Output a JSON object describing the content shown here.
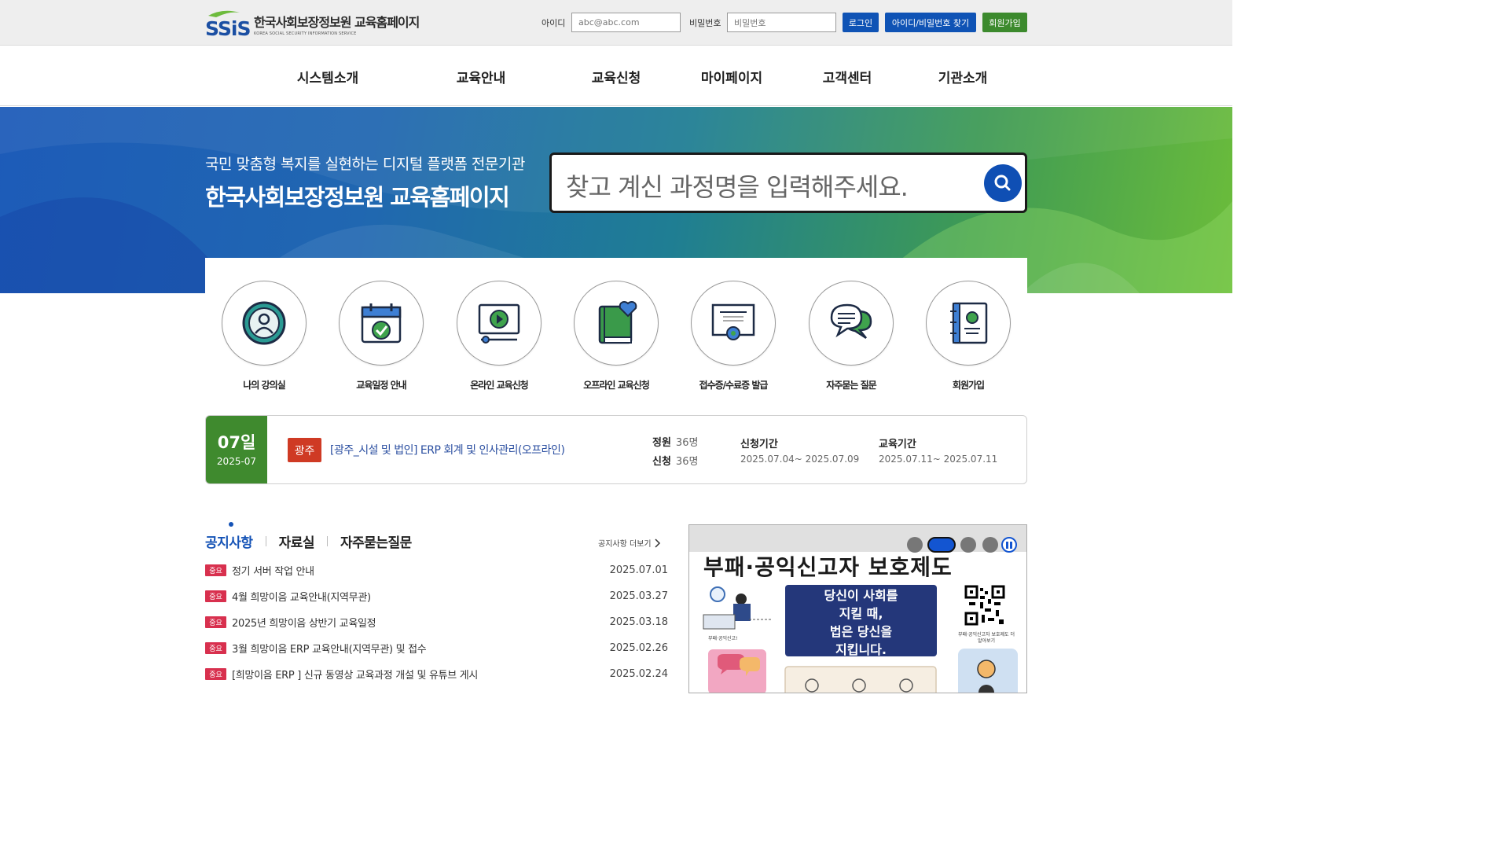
{
  "header": {
    "logo_title": "한국사회보장정보원 교육홈페이지",
    "logo_subtitle": "KOREA SOCIAL SECURITY INFORMATION SERVICE",
    "id_label": "아이디",
    "id_placeholder": "abc@abc.com",
    "pw_label": "비밀번호",
    "pw_placeholder": "비밀번호",
    "login_button": "로그인",
    "find_button": "아이디/비밀번호 찾기",
    "join_button": "회원가입"
  },
  "nav": {
    "items": [
      "시스템소개",
      "교육안내",
      "교육신청",
      "마이페이지",
      "고객센터",
      "기관소개"
    ]
  },
  "hero": {
    "subtitle": "국민 맞춤형 복지를 실현하는 디지털 플랫폼 전문기관",
    "title": "한국사회보장정보원 교육홈페이지",
    "search_placeholder": "찾고 계신 과정명을 입력해주세요."
  },
  "quick_menu": [
    {
      "label": "나의 강의실",
      "icon": "user-circle-icon"
    },
    {
      "label": "교육일정 안내",
      "icon": "calendar-check-icon"
    },
    {
      "label": "온라인 교육신청",
      "icon": "video-play-icon"
    },
    {
      "label": "오프라인 교육신청",
      "icon": "book-heart-icon"
    },
    {
      "label": "접수증/수료증 발급",
      "icon": "certificate-icon"
    },
    {
      "label": "자주묻는 질문",
      "icon": "chat-bubbles-icon"
    },
    {
      "label": "회원가입",
      "icon": "address-book-icon"
    }
  ],
  "schedule": {
    "day": "07일",
    "month": "2025-07",
    "region": "광주",
    "title": "[광주_시설 및 법인] ERP 회계 및 인사관리(오프라인)",
    "capacity_label": "정원",
    "capacity_value": "36명",
    "applied_label": "신청",
    "applied_value": "36명",
    "apply_period_label": "신청기간",
    "apply_period": "2025.07.04~ 2025.07.09",
    "edu_period_label": "교육기간",
    "edu_period": "2025.07.11~ 2025.07.11"
  },
  "board": {
    "tabs": [
      "공지사항",
      "자료실",
      "자주묻는질문"
    ],
    "more_label": "공지사항 더보기",
    "badge": "중요",
    "notices": [
      {
        "title": "정기 서버 작업 안내",
        "date": "2025.07.01"
      },
      {
        "title": "4월 희망이음 교육안내(지역무관)",
        "date": "2025.03.27"
      },
      {
        "title": "2025년 희망이음 상반기 교육일정",
        "date": "2025.03.18"
      },
      {
        "title": "3월 희망이음 ERP 교육안내(지역무관) 및 접수",
        "date": "2025.02.26"
      },
      {
        "title": "[희망이음 ERP ] 신규 동영상 교육과정 개설 및 유튜브 게시",
        "date": "2025.02.24"
      }
    ]
  },
  "banner": {
    "title": "부패·공익신고자 보호제도",
    "box_line1": "당신이 사회를",
    "box_line2": "지킬 때,",
    "box_line3": "법은 당신을",
    "box_line4": "지킵니다.",
    "qr_caption": "부패·공익신고자 보호제도 더 알아보기",
    "figure_caption": "부패·공익신고!"
  },
  "colors": {
    "primary_blue": "#0f53b5",
    "green": "#3f8a2e",
    "important_red": "#d8304e",
    "region_red": "#cf3a24"
  }
}
